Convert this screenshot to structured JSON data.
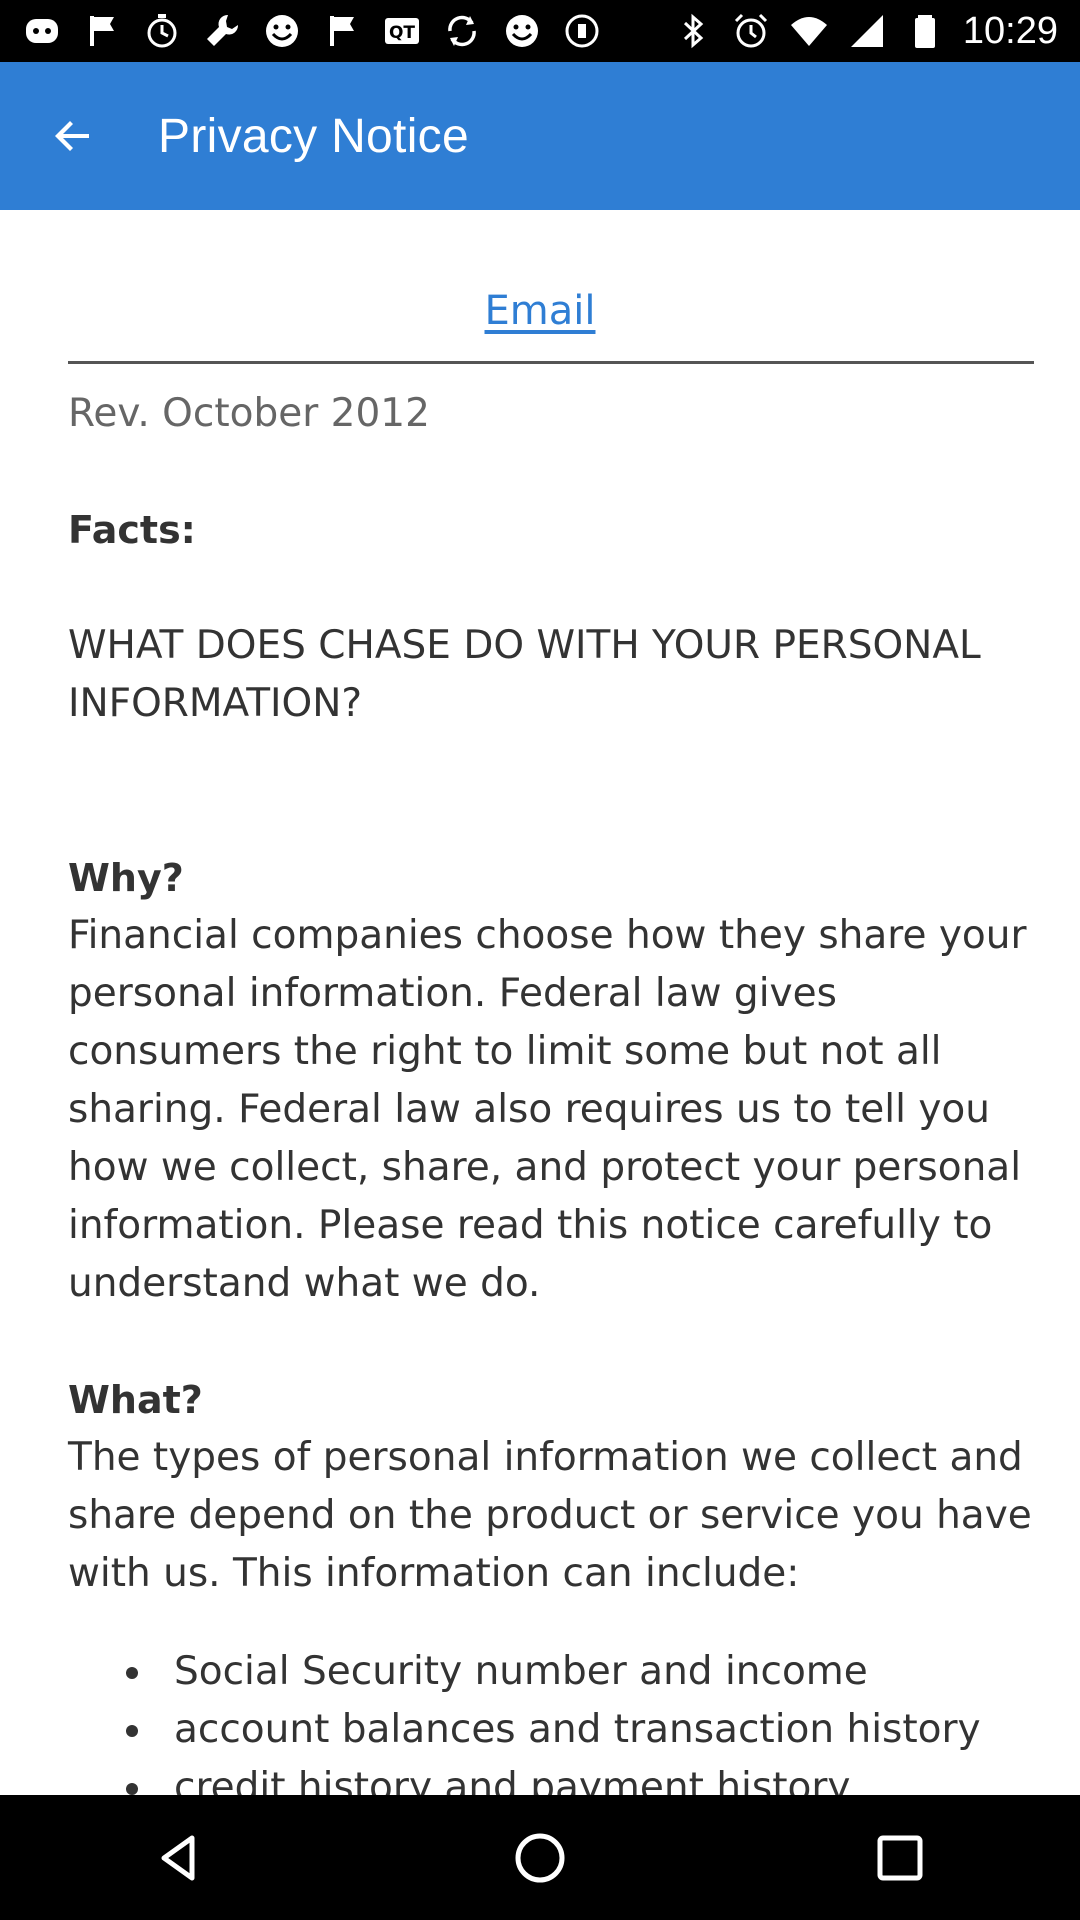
{
  "status_bar": {
    "time": "10:29",
    "left_icons": [
      "discord-icon",
      "flag-icon",
      "timer-icon",
      "wrench-icon",
      "smiley-icon",
      "flag-icon",
      "qt-icon",
      "sync-icon",
      "smiley-icon",
      "stop-icon"
    ],
    "right_icons": [
      "bluetooth-icon",
      "alarm-icon",
      "wifi-icon",
      "signal-icon",
      "battery-icon"
    ]
  },
  "app_bar": {
    "title": "Privacy Notice",
    "color": "#2f7ed4"
  },
  "email_link": "Email",
  "document": {
    "revision": "Rev. October 2012",
    "facts_heading": "Facts:",
    "facts_question": "WHAT DOES CHASE DO WITH YOUR PERSONAL INFORMATION?",
    "why_heading": "Why?",
    "why_text": "Financial companies choose how they share your personal information. Federal law gives consumers the right to limit some but not all sharing. Federal law also requires us to tell you how we collect, share, and protect your personal information. Please read this notice carefully to understand what we do.",
    "what_heading": "What?",
    "what_text": "The types of personal information we collect and share depend on the product or service you have with us. This information can include:",
    "bullets": [
      "Social Security number and income",
      "account balances and transaction history",
      "credit history and payment history"
    ]
  },
  "nav_bar": {
    "buttons": [
      "back-triangle-icon",
      "home-circle-icon",
      "recents-square-icon"
    ]
  }
}
